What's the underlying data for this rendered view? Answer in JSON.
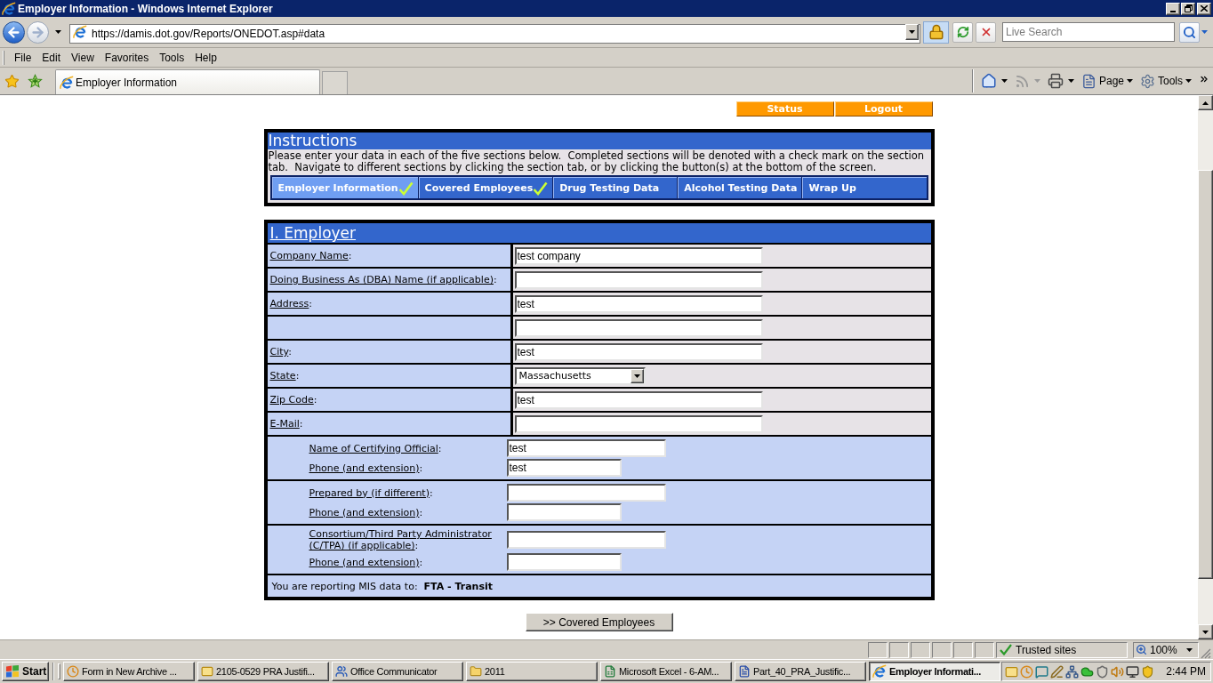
{
  "window": {
    "title": "Employer Information - Windows Internet Explorer"
  },
  "address_bar": {
    "url": "https://damis.dot.gov/Reports/ONEDOT.asp#data"
  },
  "search": {
    "placeholder": "Live Search"
  },
  "menu": [
    "File",
    "Edit",
    "View",
    "Favorites",
    "Tools",
    "Help"
  ],
  "tabs": [
    {
      "label": "Employer Information",
      "selected": true
    }
  ],
  "command_bar": [
    "Page",
    "Tools"
  ],
  "page": {
    "top_buttons": [
      "Status",
      "Logout"
    ],
    "instructions": {
      "title": "Instructions",
      "text": "Please enter your data in each of the five sections below.  Completed sections will be denoted with a check mark on the section tab.  Navigate to different sections by clicking the section tab, or by clicking the button(s) at the bottom of the screen."
    },
    "section_tabs": [
      {
        "label": "Employer Information",
        "selected": true,
        "completed": true
      },
      {
        "label": "Covered Employees",
        "selected": false,
        "completed": true
      },
      {
        "label": "Drug Testing Data",
        "selected": false,
        "completed": false
      },
      {
        "label": "Alcohol Testing Data",
        "selected": false,
        "completed": false
      },
      {
        "label": "Wrap Up",
        "selected": false,
        "completed": false
      }
    ],
    "employer": {
      "title": "I. Employer",
      "fields": [
        {
          "label": "Company Name",
          "suffix": ":",
          "kind": "text",
          "value": "test company"
        },
        {
          "label": "Doing Business As (DBA) Name (if applicable)",
          "suffix": ":",
          "kind": "text"
        },
        {
          "label": "Address",
          "suffix": ":",
          "kind": "text",
          "value": "test"
        },
        {
          "kind": "text"
        },
        {
          "label": "City",
          "suffix": ":",
          "kind": "text",
          "value": "test"
        },
        {
          "label": "State",
          "suffix": ":",
          "kind": "select",
          "value": "Massachusetts"
        },
        {
          "label": "Zip Code",
          "suffix": ":",
          "kind": "text",
          "value": "test"
        },
        {
          "label": "E-Mail",
          "suffix": ":",
          "kind": "text"
        }
      ],
      "contact_groups": [
        {
          "rows": [
            {
              "label": "Name of Certifying Official",
              "suffix": ":",
              "kind": "name",
              "value": "test"
            },
            {
              "label": "Phone (and extension)",
              "suffix": ":",
              "kind": "phone",
              "value": "test"
            }
          ]
        },
        {
          "rows": [
            {
              "label": "Prepared by (if different)",
              "suffix": ":",
              "kind": "name"
            },
            {
              "label": "Phone (and extension)",
              "suffix": ":",
              "kind": "phone"
            }
          ]
        },
        {
          "rows": [
            {
              "label": "Consortium/Third Party Administrator (C/TPA) (if applicable)",
              "suffix": ":",
              "kind": "name"
            },
            {
              "label": "Phone (and extension)",
              "suffix": ":",
              "kind": "phone"
            }
          ]
        }
      ],
      "note": "You are reporting MIS data to:  **FTA - Transit**"
    },
    "next_button": ">> Covered Employees"
  },
  "status_bar": {
    "zone": "Trusted sites",
    "zoom": "100%"
  },
  "taskbar": {
    "start": "Start",
    "items": [
      {
        "label": "Form in New Archive ...",
        "selected": false
      },
      {
        "label": "2105-0529 PRA Justifi...",
        "selected": false
      },
      {
        "label": "Office Communicator",
        "selected": false
      },
      {
        "label": "2011",
        "selected": false
      },
      {
        "label": "Microsoft Excel - 6-AM...",
        "selected": false
      },
      {
        "label": "Part_40_PRA_Justific...",
        "selected": false
      },
      {
        "label": "Employer Informati...",
        "selected": true
      }
    ],
    "clock": "2:44 PM"
  }
}
